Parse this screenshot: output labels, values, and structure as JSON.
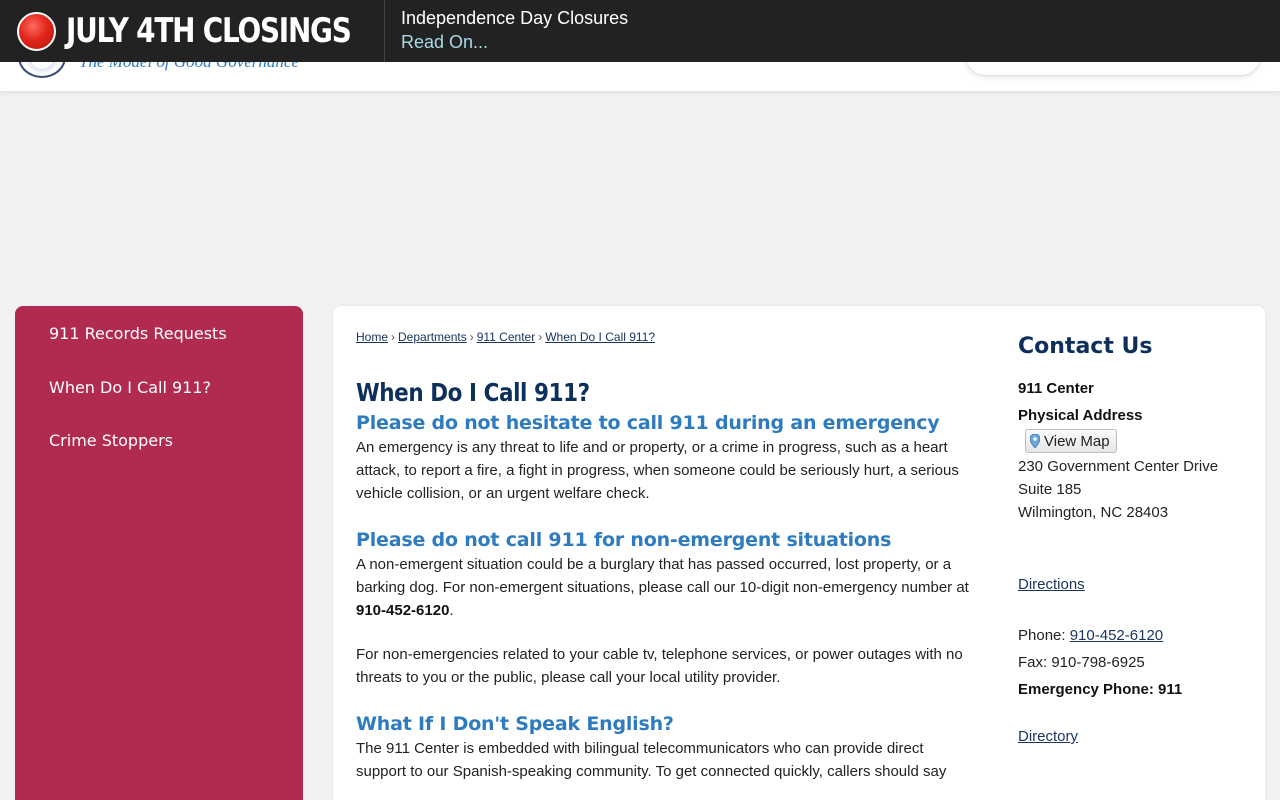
{
  "header": {
    "tagline": "The Model of Good Governance",
    "search_placeholder": ""
  },
  "alert": {
    "title": "JULY 4TH CLOSINGS",
    "heading": "Independence Day Closures",
    "link": "Read On..."
  },
  "sidebar": {
    "items": [
      {
        "label": "911 Records Requests"
      },
      {
        "label": "When Do I Call 911?"
      },
      {
        "label": "Crime Stoppers"
      }
    ]
  },
  "breadcrumb": {
    "items": [
      "Home",
      "Departments",
      "911 Center",
      "When Do I Call 911?"
    ],
    "separator": "›"
  },
  "page": {
    "title": "When Do I Call 911?",
    "sections": [
      {
        "heading": "Please do not hesitate to call 911 during an emergency",
        "text": "An emergency is any threat to life and or property, or a crime in progress, such as a heart attack, to report a fire, a fight in progress, when someone could be seriously hurt, a serious vehicle collision, or an urgent welfare check."
      },
      {
        "heading": "Please do not call 911 for non-emergent situations",
        "text_before": "A non-emergent situation could be a burglary that has passed occurred, lost property, or a barking dog. For non-emergent situations, please call our 10-digit non-emergency number at ",
        "number": "910-452-6120",
        "text_after": ".",
        "text2": "For non-emergencies related to your cable tv, telephone services, or power outages with no threats to you or the public, please call your local utility provider."
      },
      {
        "heading": "What If I Don't Speak English?",
        "text": "The 911 Center is embedded with bilingual telecommunicators who can provide direct support to our Spanish-speaking community. To get connected quickly, callers should say"
      }
    ]
  },
  "contact": {
    "title": "Contact Us",
    "org": "911 Center",
    "address_label": "Physical Address",
    "view_map": "View Map",
    "address_line1": "230 Government Center Drive",
    "address_line2": "Suite 185",
    "address_line3": "Wilmington, NC 28403",
    "directions": "Directions",
    "phone_label": "Phone: ",
    "phone": "910-452-6120",
    "fax_label": "Fax: ",
    "fax": "910-798-6925",
    "emergency": "Emergency Phone: 911",
    "directory": "Directory"
  },
  "colors": {
    "alert_bg": "#222222",
    "sidebar_bg": "#b02b4f",
    "heading_blue": "#2f7bbf",
    "title_navy": "#0d2f5c"
  }
}
